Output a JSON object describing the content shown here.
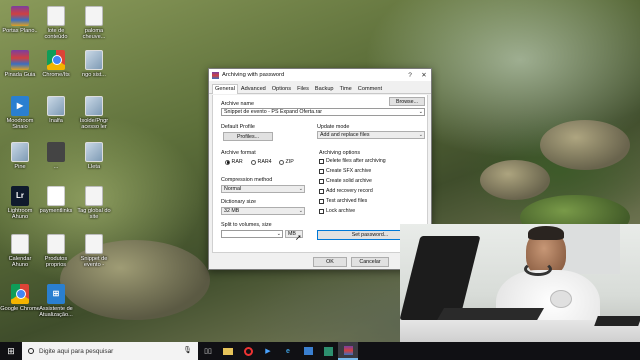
{
  "desktop": {
    "icons": [
      {
        "label": "Portas Plano..",
        "icon": "rar-icon"
      },
      {
        "label": "lote de conteúdo",
        "icon": "document-icon"
      },
      {
        "label": "paloma cheuve...",
        "icon": "document-icon"
      },
      {
        "label": "Pinada Guia",
        "icon": "rar-icon"
      },
      {
        "label": "Chrome/Its",
        "icon": "chrome-icon"
      },
      {
        "label": "ngo sist...",
        "icon": "image-icon"
      },
      {
        "label": "Moodroom Sinaio",
        "icon": "app-icon"
      },
      {
        "label": "Inalfa",
        "icon": "image-icon"
      },
      {
        "label": "Isolde/Pngr acesso ler",
        "icon": "image-icon"
      },
      {
        "label": "Pine",
        "icon": "image-icon"
      },
      {
        "label": "...",
        "icon": "image-icon"
      },
      {
        "label": "Lleta",
        "icon": "image-icon"
      },
      {
        "label": "Lightroom Ahuno",
        "icon": "lightroom-icon"
      },
      {
        "label": "paymentlinks",
        "icon": "pdf-icon"
      },
      {
        "label": "Tag global do site",
        "icon": "document-icon"
      },
      {
        "label": "Calendar Ahuno",
        "icon": "document-icon"
      },
      {
        "label": "Produtos proprios",
        "icon": "document-icon"
      },
      {
        "label": "Snippet de evento -",
        "icon": "document-icon"
      },
      {
        "label": "Google Chrome",
        "icon": "chrome-icon"
      },
      {
        "label": "Assistente de Atualização...",
        "icon": "windows-icon"
      }
    ]
  },
  "dialog": {
    "title": "Archiving with password",
    "help": "?",
    "close": "✕",
    "tabs": [
      "General",
      "Advanced",
      "Options",
      "Files",
      "Backup",
      "Time",
      "Comment"
    ],
    "archive_name_label": "Archive name",
    "archive_name_value": "Snippet de evento - PS Expand Oferta.rar",
    "browse_label": "Browse...",
    "default_profile_label": "Default Profile",
    "profiles_label": "Profiles...",
    "update_mode_label": "Update mode",
    "update_mode_value": "Add and replace files",
    "archive_format_label": "Archive format",
    "formats": [
      {
        "label": "RAR",
        "selected": true
      },
      {
        "label": "RAR4",
        "selected": false
      },
      {
        "label": "ZIP",
        "selected": false
      }
    ],
    "archiving_options_label": "Archiving options",
    "options": [
      "Delete files after archiving",
      "Create SFX archive",
      "Create solid archive",
      "Add recovery record",
      "Test archived files",
      "Lock archive"
    ],
    "compression_method_label": "Compression method",
    "compression_method_value": "Normal",
    "dictionary_size_label": "Dictionary size",
    "dictionary_size_value": "32 MB",
    "split_label": "Split to volumes, size",
    "split_value": "",
    "split_unit": "MB",
    "set_password_label": "Set password...",
    "ok_label": "OK",
    "cancel_label": "Cancelar"
  },
  "taskbar": {
    "search_placeholder": "Digite aqui para pesquisar",
    "apps": [
      "task-view-icon",
      "folder-icon",
      "opera-icon",
      "media-player-icon",
      "edge-icon",
      "store-icon",
      "unknown-app-icon",
      "winrar-icon"
    ]
  },
  "colors": {
    "accent": "#0078d7",
    "taskbar": "#101014",
    "dialog_bg": "#f0f0f0"
  }
}
